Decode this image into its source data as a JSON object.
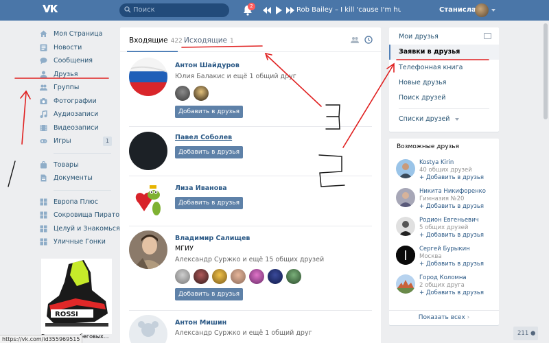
{
  "topbar": {
    "logo_icon": "vk-logo-icon",
    "search_placeholder": "Поиск",
    "notifications_count": "2",
    "track_title": "Rob Bailey – I kill 'cause I'm hungry(O...",
    "user_name": "Станислав"
  },
  "left_nav": {
    "items": [
      {
        "label": "Моя Страница",
        "icon": "home-icon"
      },
      {
        "label": "Новости",
        "icon": "news-icon"
      },
      {
        "label": "Сообщения",
        "icon": "messages-icon"
      },
      {
        "label": "Друзья",
        "icon": "friends-icon"
      },
      {
        "label": "Группы",
        "icon": "groups-icon"
      },
      {
        "label": "Фотографии",
        "icon": "camera-icon"
      },
      {
        "label": "Аудиозаписи",
        "icon": "music-icon"
      },
      {
        "label": "Видеозаписи",
        "icon": "video-icon"
      },
      {
        "label": "Игры",
        "icon": "gamepad-icon",
        "badge": "1"
      }
    ],
    "items2": [
      {
        "label": "Товары",
        "icon": "bag-icon"
      },
      {
        "label": "Документы",
        "icon": "document-icon"
      }
    ],
    "apps": [
      {
        "label": "Европа Плюс"
      },
      {
        "label": "Сокровища Пиратов"
      },
      {
        "label": "Целуй и Знакомься"
      },
      {
        "label": "Уличные Гонки"
      }
    ],
    "ad_text": "Ботинки для беговых..."
  },
  "status_url": "https://vk.com/id355969515",
  "main": {
    "tab_incoming_label": "Входящие",
    "tab_incoming_count": "422",
    "tab_outgoing_label": "Исходящие",
    "tab_outgoing_count": "1",
    "add_button_label": "Добавить в друзья",
    "requests": [
      {
        "name": "Антон Шайдуров",
        "line1": "Юлия Балакис и ещё 1 общий друг",
        "line2": ""
      },
      {
        "name": "Павел Соболев",
        "line1": "",
        "line2": ""
      },
      {
        "name": "Лиза Иванова",
        "line1": "",
        "line2": ""
      },
      {
        "name": "Владимир Салищев",
        "line1": "МГИУ",
        "line2": "Александр Суржко и ещё 15 общих друзей"
      },
      {
        "name": "Антон Мишин",
        "line1": "Александр Суржко и ещё 1 общий друг",
        "line2": ""
      }
    ]
  },
  "right_nav": {
    "items": [
      {
        "label": "Мои друзья"
      },
      {
        "label": "Заявки в друзья"
      },
      {
        "label": "Телефонная книга"
      },
      {
        "label": "Новые друзья"
      },
      {
        "label": "Поиск друзей"
      }
    ],
    "lists_label": "Списки друзей"
  },
  "possible_friends": {
    "title": "Возможные друзья",
    "add_label": "+ Добавить в друзья",
    "show_all_label": "Показать всех",
    "items": [
      {
        "name": "Kostya Kirin",
        "sub": "40 общих друзей"
      },
      {
        "name": "Никита Никифоренко",
        "sub": "Гимназия №20"
      },
      {
        "name": "Родион Евгеньевич",
        "sub": "5 общих друзей"
      },
      {
        "name": "Сергей Бурыкин",
        "sub": "Москва"
      },
      {
        "name": "Город Коломна",
        "sub": "2 общих друга"
      }
    ]
  },
  "bottom_counter": "211",
  "annotations": {
    "numbers": [
      "1",
      "2",
      "3"
    ],
    "color": "#e02020"
  }
}
